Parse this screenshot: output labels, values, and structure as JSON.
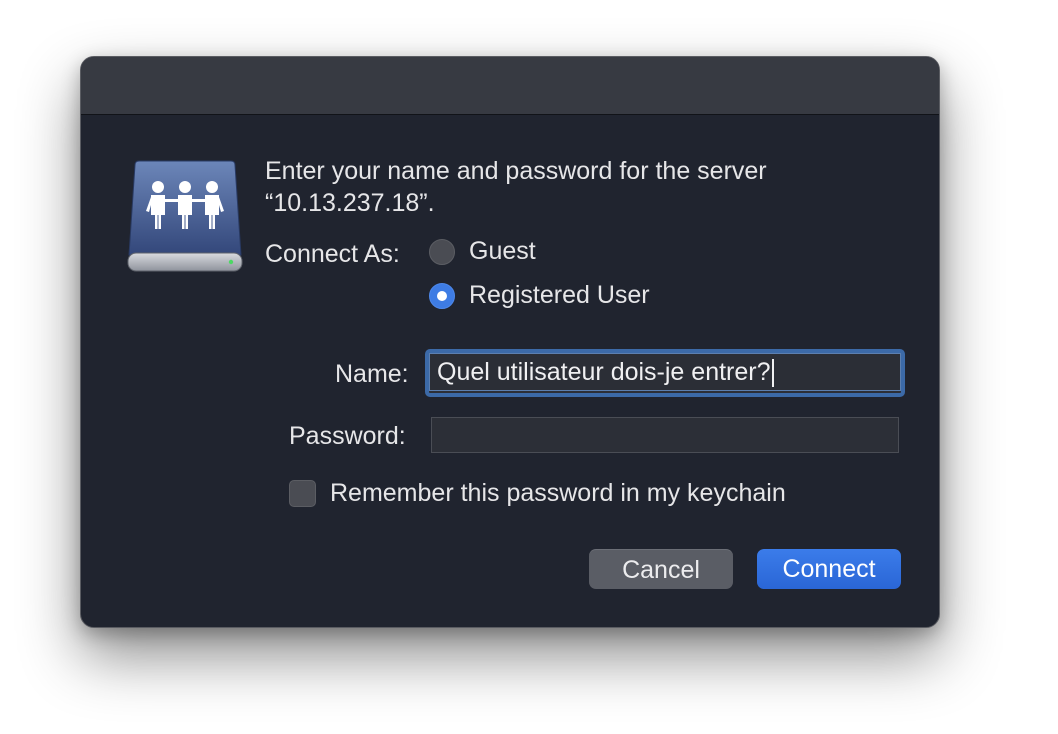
{
  "dialog": {
    "message_line1": "Enter your name and password for the server",
    "message_line2": "“10.13.237.18”.",
    "connect_as_label": "Connect As:",
    "options": [
      {
        "label": "Guest",
        "selected": false
      },
      {
        "label": "Registered User",
        "selected": true
      }
    ],
    "name_label": "Name:",
    "name_value": "Quel utilisateur dois-je entrer?",
    "password_label": "Password:",
    "password_value": "",
    "remember_label": "Remember this password in my keychain",
    "remember_checked": false,
    "cancel_label": "Cancel",
    "connect_label": "Connect"
  },
  "icons": {
    "server": "shared-server-icon"
  },
  "colors": {
    "accent": "#3e7ce4",
    "background": "#20242f",
    "titlebar": "#373a42"
  }
}
